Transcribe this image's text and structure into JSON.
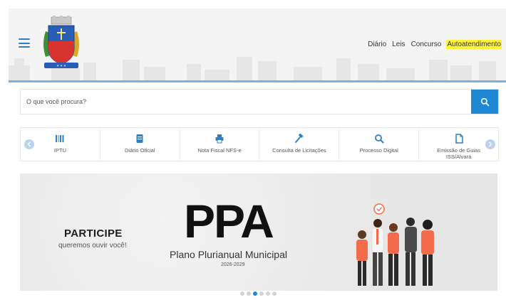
{
  "header": {
    "nav": [
      {
        "label": "Diário",
        "highlight": false
      },
      {
        "label": "Leis",
        "highlight": false
      },
      {
        "label": "Concurso",
        "highlight": false
      },
      {
        "label": "Autoatendimento",
        "highlight": true
      }
    ],
    "logo_icon": "municipal-coat-of-arms",
    "menu_icon": "hamburger-icon"
  },
  "search": {
    "placeholder": "O que você procura?",
    "icon": "search-icon"
  },
  "quick_access": [
    {
      "label": "IPTU",
      "icon": "barcode-icon"
    },
    {
      "label": "Diário Oficial",
      "icon": "document-icon"
    },
    {
      "label": "Nota Fiscal NFS-e",
      "icon": "printer-icon"
    },
    {
      "label": "Consulta de Licitações",
      "icon": "hammer-icon"
    },
    {
      "label": "Processo Digital",
      "icon": "search-icon"
    },
    {
      "label": "Emissão de Guias ISS/Alvará",
      "icon": "file-icon"
    }
  ],
  "banner": {
    "participe": "PARTICIPE",
    "queremos": "queremos ouvir você!",
    "ppa": "PPA",
    "subtitle": "Plano Plurianual Municipal",
    "years": "2026-2029"
  },
  "carousel": {
    "count": 6,
    "active_index": 2
  },
  "colors": {
    "accent": "#1e88d4",
    "highlight": "#fff43a",
    "banner_orange": "#f26b4b"
  }
}
